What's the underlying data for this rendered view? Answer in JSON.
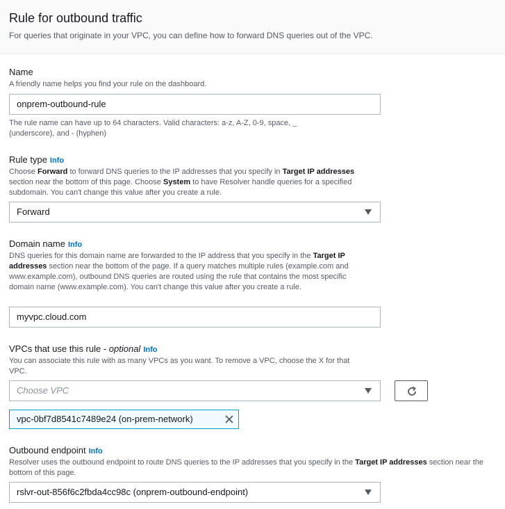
{
  "header": {
    "title": "Rule for outbound traffic",
    "description": "For queries that originate in your VPC, you can define how to forward DNS queries out of the VPC."
  },
  "name": {
    "label": "Name",
    "hint": "A friendly name helps you find your rule on the dashboard.",
    "value": "onprem-outbound-rule",
    "constraint_line1": "The rule name can have up to 64 characters. Valid characters: a-z, A-Z, 0-9, space, _",
    "constraint_line2": "(underscore), and - (hyphen)"
  },
  "rule_type": {
    "label": "Rule type",
    "info": "Info",
    "desc": {
      "p1": "Choose ",
      "b1": "Forward",
      "p2": " to forward DNS queries to the IP addresses that you specify in ",
      "b2": "Target IP addresses",
      "p3": " section near the bottom of this page. Choose ",
      "b3": "System",
      "p4": " to have Resolver handle queries for a specified subdomain. You can't change this value after you create a rule."
    },
    "selected": "Forward"
  },
  "domain_name": {
    "label": "Domain name",
    "info": "Info",
    "desc": {
      "p1": "DNS queries for this domain name are forwarded to the IP address that you specify in the ",
      "b1": "Target IP addresses",
      "p2": " section near the bottom of the page. If a query matches multiple rules (example.com and www.example.com), outbound DNS queries are routed using the rule that contains the most specific domain name (www.example.com). You can't change this value after you create a rule."
    },
    "value": "myvpc.cloud.com"
  },
  "vpcs": {
    "label": "VPCs that use this rule - ",
    "optional": "optional",
    "info": "Info",
    "desc": "You can associate this rule with as many VPCs as you want. To remove a VPC, choose the X for that VPC.",
    "placeholder": "Choose VPC",
    "selected_token": "vpc-0bf7d8541c7489e24 (on-prem-network)"
  },
  "outbound_endpoint": {
    "label": "Outbound endpoint",
    "info": "Info",
    "desc": {
      "p1": "Resolver uses the outbound endpoint to route DNS queries to the IP addresses that you specify in the ",
      "b1": "Target IP addresses",
      "p2": " section near the bottom of this page."
    },
    "selected": "rslvr-out-856f6c2fbda4cc98c (onprem-outbound-endpoint)"
  },
  "icons": {
    "caret": "caret-down-icon",
    "refresh": "refresh-icon",
    "remove": "close-icon"
  }
}
